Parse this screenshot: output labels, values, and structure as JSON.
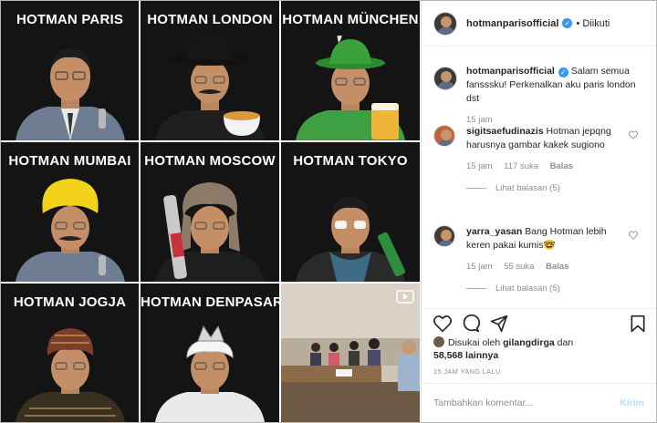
{
  "grid": {
    "tiles": [
      {
        "title": "HOTMAN PARIS"
      },
      {
        "title": "HOTMAN LONDON"
      },
      {
        "title": "HOTMAN MÜNCHEN"
      },
      {
        "title": "HOTMAN MUMBAI"
      },
      {
        "title": "HOTMAN MOSCOW"
      },
      {
        "title": "HOTMAN TOKYO"
      },
      {
        "title": "HOTMAN JOGJA"
      },
      {
        "title": "HOTMAN DENPASAR"
      }
    ]
  },
  "header": {
    "username": "hotmanparisofficial",
    "follow_status": "• Diikuti"
  },
  "caption": {
    "username": "hotmanparisofficial",
    "text": "Salam semua fansssku! Perkenalkan aku paris london dst",
    "time": "15 jam"
  },
  "comments": [
    {
      "username": "sigitsaefudinazis",
      "text": "Hotman jepqng harusnya gambar kakek sugiono",
      "time": "15 jam",
      "likes": "117 suka",
      "reply_label": "Balas",
      "view_replies": "Lihat balasan (5)"
    },
    {
      "username": "yarra_yasan",
      "text": "Bang Hotman lebih keren pakai kumis🤓",
      "time": "15 jam",
      "likes": "55 suka",
      "reply_label": "Balas",
      "view_replies": "Lihat balasan (5)"
    }
  ],
  "likes": {
    "prefix": "Disukai oleh",
    "user": "gilangdirga",
    "connector": "dan",
    "count": "58,568",
    "suffix": "lainnya"
  },
  "timestamp": "15 JAM YANG LALU",
  "comment_box": {
    "placeholder": "Tambahkan komentar...",
    "post_label": "Kirim"
  },
  "colors": {
    "tile_bg": "#141414",
    "verified": "#3897f0",
    "post_disabled": "#b2dffc"
  }
}
